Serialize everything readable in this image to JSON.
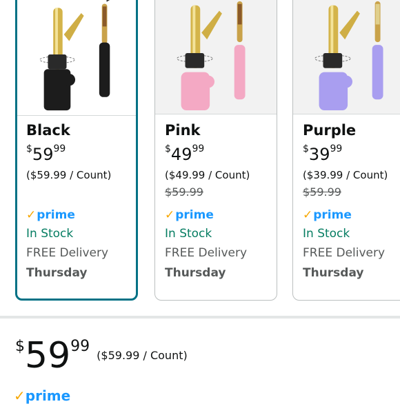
{
  "variants": [
    {
      "color": "Black",
      "price_symbol": "$",
      "price_whole": "59",
      "price_fraction": "99",
      "unit_price": "($59.99 / Count)",
      "list_price": "",
      "prime_check": "✓",
      "prime_label": "prime",
      "stock": "In Stock",
      "delivery": "FREE Delivery",
      "delivery_day": "Thursday",
      "selected": true,
      "product_color": "#1c1c1c"
    },
    {
      "color": "Pink",
      "price_symbol": "$",
      "price_whole": "49",
      "price_fraction": "99",
      "unit_price": "($49.99 / Count)",
      "list_price": "$59.99",
      "prime_check": "✓",
      "prime_label": "prime",
      "stock": "In Stock",
      "delivery": "FREE Delivery",
      "delivery_day": "Thursday",
      "selected": false,
      "product_color": "#f4a9c4"
    },
    {
      "color": "Purple",
      "price_symbol": "$",
      "price_whole": "39",
      "price_fraction": "99",
      "unit_price": "($39.99 / Count)",
      "list_price": "$59.99",
      "prime_check": "✓",
      "prime_label": "prime",
      "stock": "In Stock",
      "delivery": "FREE Delivery",
      "delivery_day": "Thursday",
      "selected": false,
      "product_color": "#a99ef0"
    }
  ],
  "main_price": {
    "symbol": "$",
    "whole": "59",
    "fraction": "99",
    "unit_price": "($59.99 / Count)"
  },
  "main_prime": {
    "check": "✓",
    "label": "prime"
  },
  "colors": {
    "selected_border": "#007185",
    "in_stock": "#067d62",
    "prime_blue": "#1a98ff",
    "prime_check": "#f7a700"
  }
}
